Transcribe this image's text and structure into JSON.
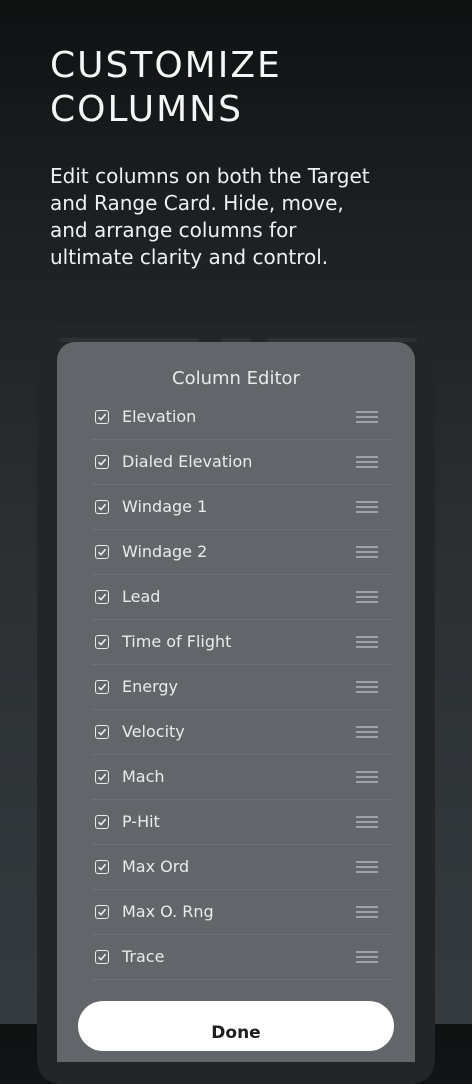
{
  "hero": {
    "title_line1": "CUSTOMIZE",
    "title_line2": "COLUMNS",
    "description": "Edit columns on both the Target and Range Card. Hide, move, and arrange columns for ultimate clarity and control."
  },
  "editor": {
    "title": "Column Editor",
    "columns": [
      {
        "label": "Elevation",
        "checked": true
      },
      {
        "label": "Dialed Elevation",
        "checked": true
      },
      {
        "label": "Windage 1",
        "checked": true
      },
      {
        "label": "Windage 2",
        "checked": true
      },
      {
        "label": "Lead",
        "checked": true
      },
      {
        "label": "Time of Flight",
        "checked": true
      },
      {
        "label": "Energy",
        "checked": true
      },
      {
        "label": "Velocity",
        "checked": true
      },
      {
        "label": "Mach",
        "checked": true
      },
      {
        "label": "P-Hit",
        "checked": true
      },
      {
        "label": "Max Ord",
        "checked": true
      },
      {
        "label": "Max O. Rng",
        "checked": true
      },
      {
        "label": "Trace",
        "checked": true
      }
    ],
    "done_label": "Done"
  },
  "colors": {
    "sheet": "#62666a",
    "text": "#e9ebec",
    "button": "#ffffff"
  }
}
